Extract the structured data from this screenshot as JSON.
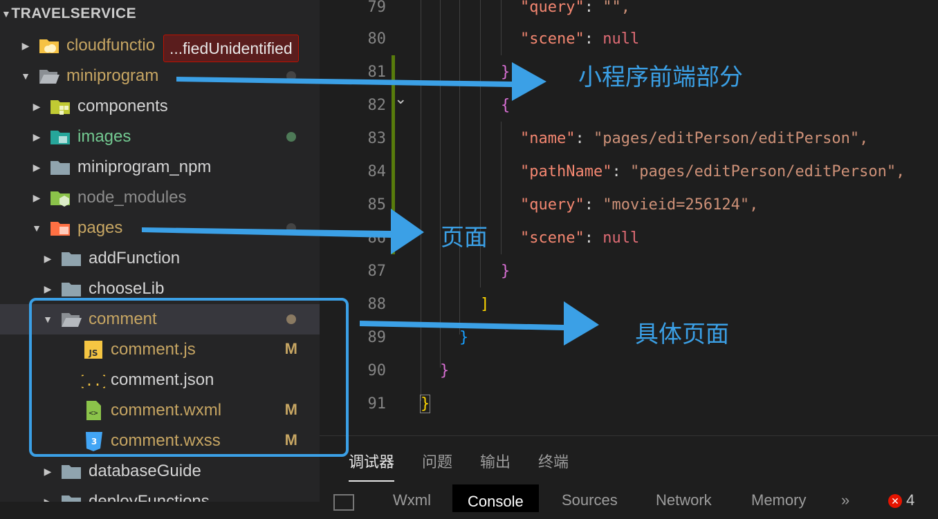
{
  "explorer": {
    "section_title": "TRAVELSERVICE",
    "tooltip": "...fiedUnidentified",
    "items": [
      {
        "label": "cloudfunctio",
        "color": "#c7a663",
        "icon": "cloud-folder-icon"
      },
      {
        "label": "miniprogram",
        "color": "#c7a663",
        "icon": "folder-open-icon"
      },
      {
        "label": "components",
        "color": "#d4d4d4",
        "icon": "components-folder-icon"
      },
      {
        "label": "images",
        "color": "#73c991",
        "icon": "images-folder-icon"
      },
      {
        "label": "miniprogram_npm",
        "color": "#d4d4d4",
        "icon": "folder-icon"
      },
      {
        "label": "node_modules",
        "color": "#8c8c8c",
        "icon": "node-folder-icon"
      },
      {
        "label": "pages",
        "color": "#c7a663",
        "icon": "pages-folder-icon"
      },
      {
        "label": "addFunction",
        "color": "#d4d4d4",
        "icon": "folder-icon"
      },
      {
        "label": "chooseLib",
        "color": "#d4d4d4",
        "icon": "folder-icon"
      },
      {
        "label": "comment",
        "color": "#c7a663",
        "icon": "folder-open-icon"
      },
      {
        "label": "comment.js",
        "color": "#c7a663",
        "icon": "js-file-icon",
        "badge": "M"
      },
      {
        "label": "comment.json",
        "color": "#d4d4d4",
        "icon": "json-file-icon"
      },
      {
        "label": "comment.wxml",
        "color": "#c7a663",
        "icon": "wxml-file-icon",
        "badge": "M"
      },
      {
        "label": "comment.wxss",
        "color": "#c7a663",
        "icon": "css-file-icon",
        "badge": "M"
      },
      {
        "label": "databaseGuide",
        "color": "#d4d4d4",
        "icon": "folder-icon"
      },
      {
        "label": "deployFunctions",
        "color": "#d4d4d4",
        "icon": "folder-icon"
      }
    ]
  },
  "editor": {
    "lines": [
      {
        "num": "79",
        "key": "query",
        "value": "\"\","
      },
      {
        "num": "80",
        "key": "scene",
        "value": "null"
      },
      {
        "num": "81",
        "text": "},"
      },
      {
        "num": "82",
        "text": "{"
      },
      {
        "num": "83",
        "key": "name",
        "value": "\"pages/editPerson/editPerson\","
      },
      {
        "num": "84",
        "key": "pathName",
        "value": "\"pages/editPerson/editPerson\","
      },
      {
        "num": "85",
        "key": "query",
        "value": "\"movieid=256124\","
      },
      {
        "num": "86",
        "key": "scene",
        "value": "null"
      },
      {
        "num": "87",
        "text": "}"
      },
      {
        "num": "88",
        "text": "]"
      },
      {
        "num": "89",
        "text": "}"
      },
      {
        "num": "90",
        "text": "}"
      },
      {
        "num": "91",
        "text": "}"
      }
    ]
  },
  "panel": {
    "tabs": [
      "调试器",
      "问题",
      "输出",
      "终端"
    ],
    "devtools_tabs": [
      "Wxml",
      "Console",
      "Sources",
      "Network",
      "Memory",
      "»"
    ],
    "error_count": "4"
  },
  "annotations": {
    "miniprogram_note": "小程序前端部分",
    "pages_note": "页面",
    "comment_note": "具体页面",
    "arrow_color": "#3ba0e6"
  }
}
